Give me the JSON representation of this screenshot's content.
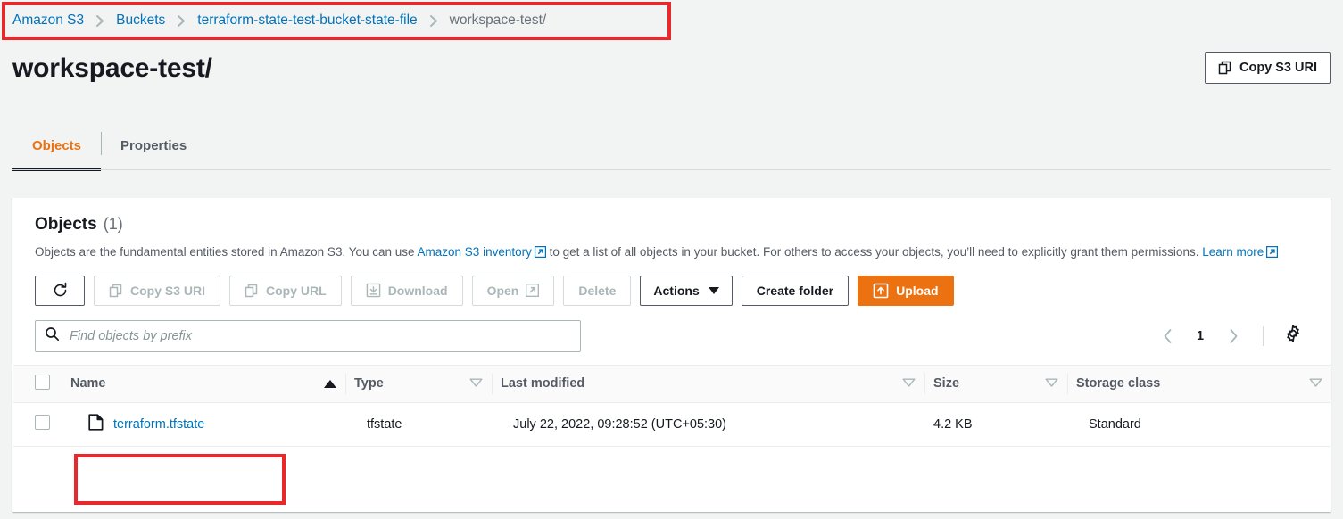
{
  "breadcrumb": {
    "items": [
      {
        "label": "Amazon S3",
        "current": false
      },
      {
        "label": "Buckets",
        "current": false
      },
      {
        "label": "terraform-state-test-bucket-state-file",
        "current": false
      },
      {
        "label": "workspace-test/",
        "current": true
      }
    ]
  },
  "header": {
    "title": "workspace-test/",
    "copy_s3_uri_label": "Copy S3 URI"
  },
  "tabs": [
    {
      "label": "Objects",
      "active": true
    },
    {
      "label": "Properties",
      "active": false
    }
  ],
  "objects_panel": {
    "title": "Objects",
    "count": "(1)",
    "description_part1": "Objects are the fundamental entities stored in Amazon S3. You can use ",
    "inventory_link": "Amazon S3 inventory",
    "description_part2": " to get a list of all objects in your bucket. For others to access your objects, you’ll need to explicitly grant them permissions. ",
    "learn_more_link": "Learn more"
  },
  "toolbar": {
    "refresh_label": "Refresh",
    "copy_s3_uri_label": "Copy S3 URI",
    "copy_url_label": "Copy URL",
    "download_label": "Download",
    "open_label": "Open",
    "delete_label": "Delete",
    "actions_label": "Actions",
    "create_folder_label": "Create folder",
    "upload_label": "Upload"
  },
  "search": {
    "placeholder": "Find objects by prefix",
    "value": ""
  },
  "pagination": {
    "page": "1"
  },
  "table": {
    "columns": [
      {
        "label": "Name",
        "sort": "asc"
      },
      {
        "label": "Type",
        "sort": "idle"
      },
      {
        "label": "Last modified",
        "sort": "idle"
      },
      {
        "label": "Size",
        "sort": "idle"
      },
      {
        "label": "Storage class",
        "sort": "idle"
      }
    ],
    "rows": [
      {
        "name": "terraform.tfstate",
        "type": "tfstate",
        "last_modified": "July 22, 2022, 09:28:52 (UTC+05:30)",
        "size": "4.2 KB",
        "storage_class": "Standard"
      }
    ]
  },
  "colors": {
    "accent_orange": "#ec7211",
    "link_blue": "#0073bb",
    "annotation_red": "#e8282a"
  }
}
